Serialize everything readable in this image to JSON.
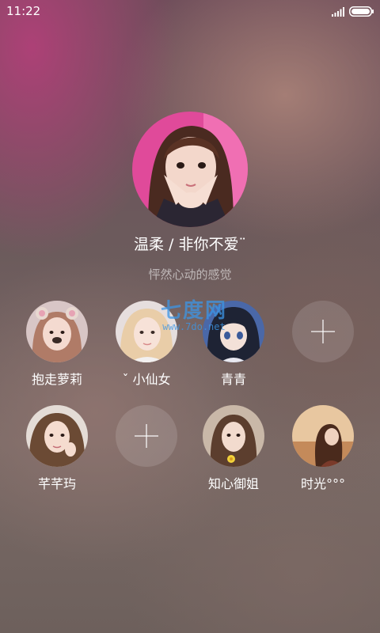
{
  "status_bar": {
    "time": "11:22"
  },
  "profile": {
    "name": "温柔 / 非你不爱¨",
    "tagline": "怦然心动的感觉"
  },
  "contacts": {
    "c1": {
      "label": "抱走萝莉"
    },
    "c2": {
      "label": "ˇ 小仙女"
    },
    "c3": {
      "label": "青青"
    },
    "c4": {
      "label": "芊芊玙"
    },
    "c5": {
      "label": "知心御姐"
    },
    "c6": {
      "label": "时光°°°"
    }
  },
  "watermark": {
    "big": "七度网",
    "small": "www.7do.net"
  },
  "icons": {
    "signal": "signal-icon",
    "battery": "battery-icon",
    "add": "plus-icon"
  },
  "colors": {
    "text": "#ffffff",
    "tagline": "rgba(255,255,255,0.55)",
    "add_circle": "rgba(255,255,255,0.13)"
  }
}
